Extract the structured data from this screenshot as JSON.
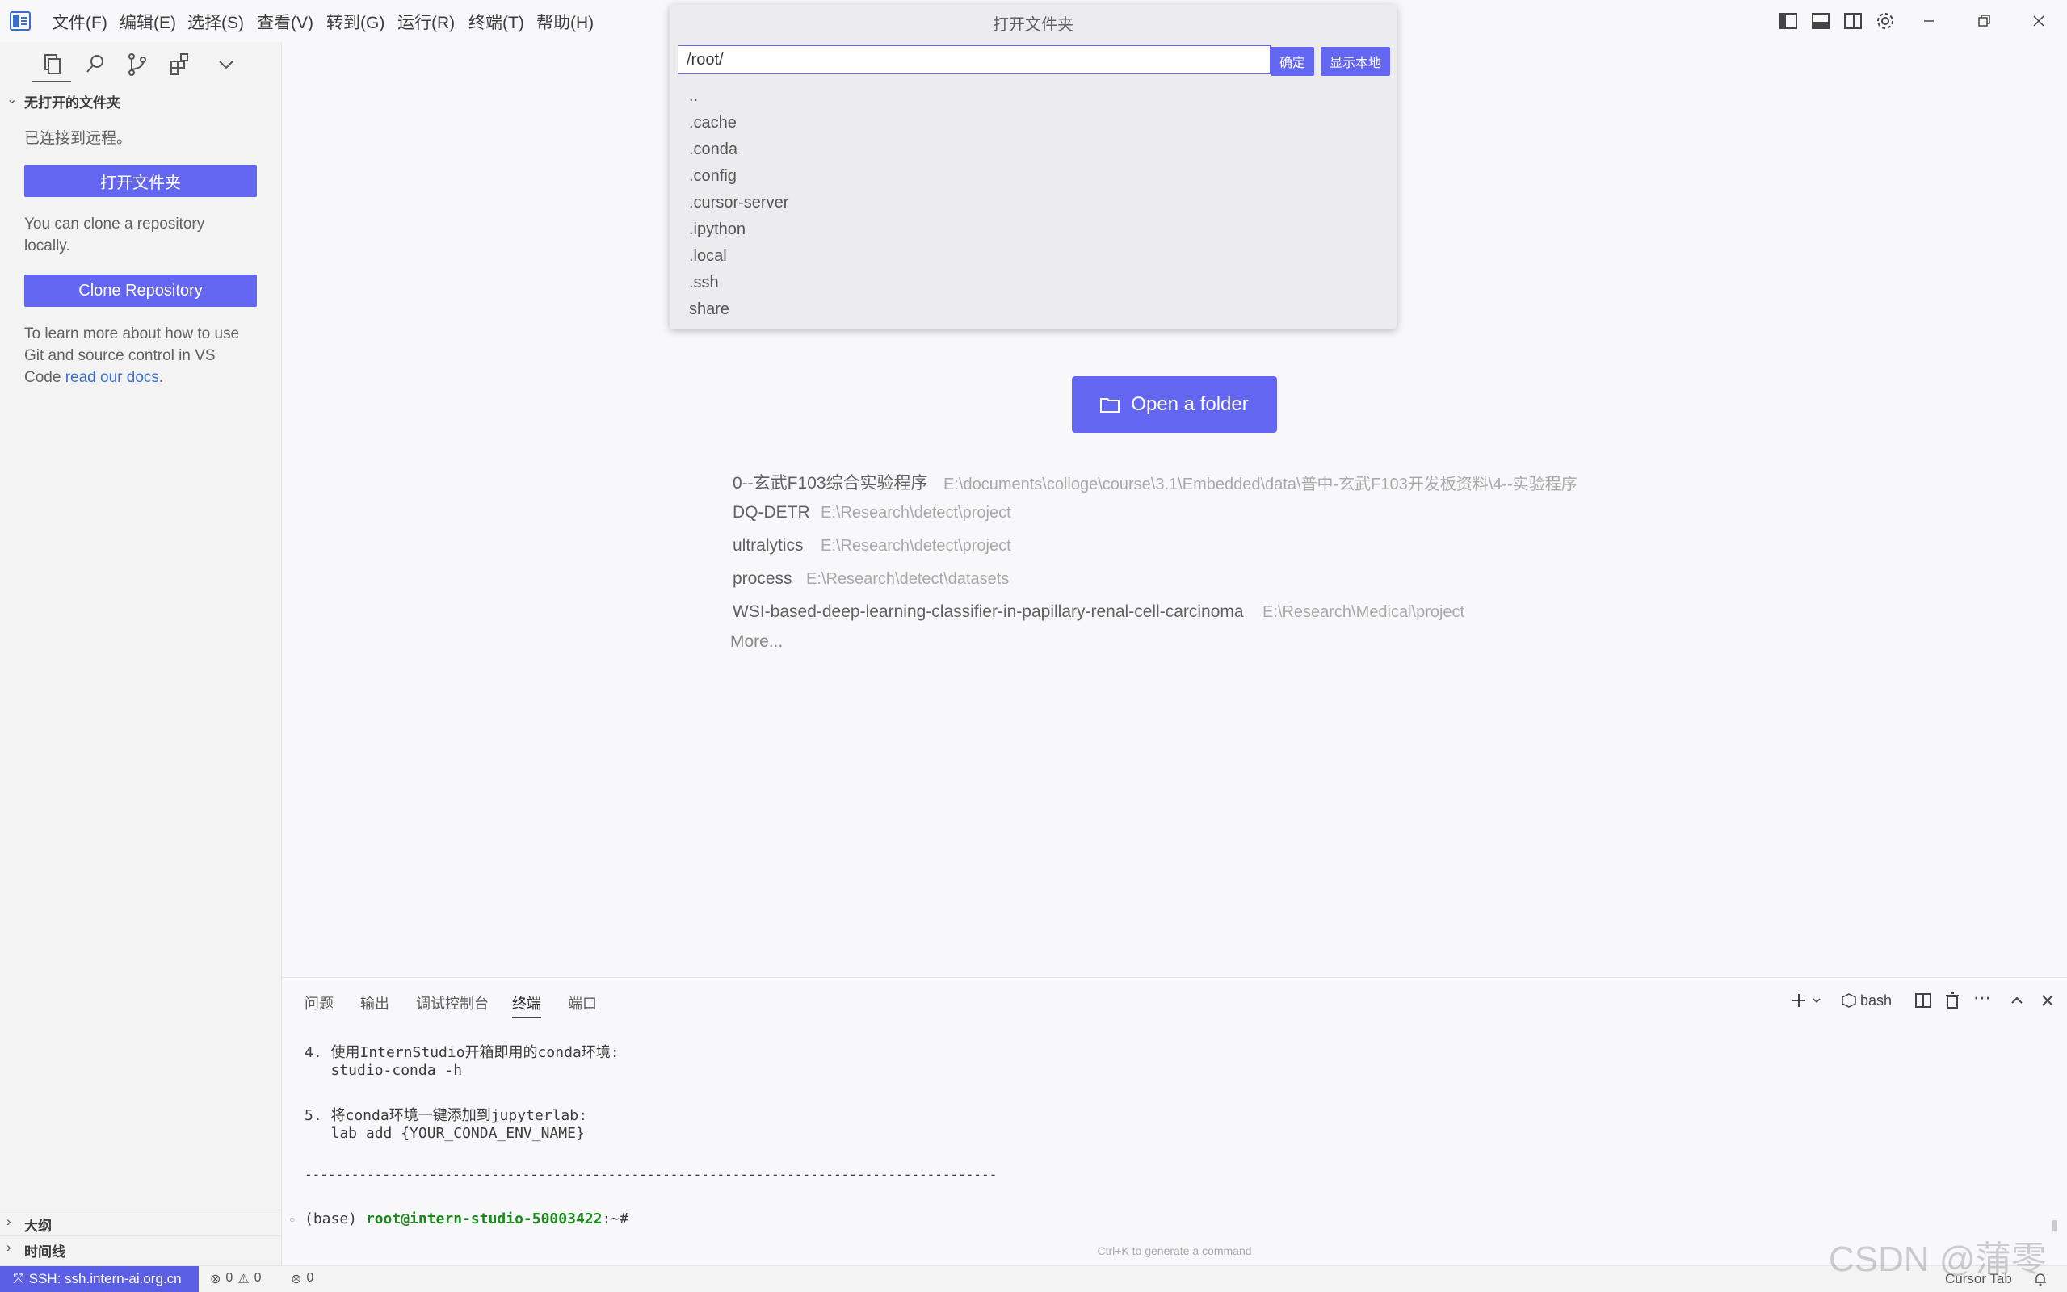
{
  "menu": [
    "文件(F)",
    "编辑(E)",
    "选择(S)",
    "查看(V)",
    "转到(G)",
    "运行(R)",
    "终端(T)",
    "帮助(H)"
  ],
  "sidebar": {
    "section_title": "无打开的文件夹",
    "connected_text": "已连接到远程。",
    "open_folder_label": "打开文件夹",
    "clone_hint_line1": "You can clone a repository",
    "clone_hint_line2": "locally.",
    "clone_label": "Clone Repository",
    "learn_line1": "To learn more about how to use",
    "learn_line2": "Git and source control in VS",
    "learn_line3_prefix": "Code ",
    "learn_link": "read our docs",
    "learn_suffix": ".",
    "outline_label": "大纲",
    "timeline_label": "时间线"
  },
  "quickpick": {
    "title": "打开文件夹",
    "input_value": "/root/",
    "ok_label": "确定",
    "show_local_label": "显示本地",
    "items": [
      "..",
      ".cache",
      ".conda",
      ".config",
      ".cursor-server",
      ".ipython",
      ".local",
      ".ssh",
      "share"
    ]
  },
  "welcome": {
    "open_folder_label": "Open a folder",
    "recent": [
      {
        "name": "0--玄武F103综合实验程序",
        "path": "E:\\documents\\colloge\\course\\3.1\\Embedded\\data\\普中-玄武F103开发板资料\\4--实验程序"
      },
      {
        "name": "DQ-DETR",
        "path": "E:\\Research\\detect\\project"
      },
      {
        "name": "ultralytics",
        "path": "E:\\Research\\detect\\project"
      },
      {
        "name": "process",
        "path": "E:\\Research\\detect\\datasets"
      },
      {
        "name": "WSI-based-deep-learning-classifier-in-papillary-renal-cell-carcinoma",
        "path": "E:\\Research\\Medical\\project"
      }
    ],
    "more_label": "More..."
  },
  "panel": {
    "tabs": [
      "问题",
      "输出",
      "调试控制台",
      "终端",
      "端口"
    ],
    "active_tab": "终端",
    "shell_label": "bash",
    "terminal_lines": [
      "4. 使用InternStudio开箱即用的conda环境:",
      "   studio-conda -h",
      "",
      "5. 将conda环境一键添加到jupyterlab:",
      "   lab add {YOUR_CONDA_ENV_NAME}",
      "",
      "-----------------------------------------------------------------------------------------"
    ],
    "prompt_base": "(base) ",
    "prompt_user": "root@intern-studio-50003422",
    "prompt_suffix": ":~#",
    "hint": "Ctrl+K to generate a command"
  },
  "statusbar": {
    "remote_label": "SSH: ssh.intern-ai.org.cn",
    "errors": "0",
    "warnings": "0",
    "ports": "0",
    "right_label": "Cursor Tab"
  },
  "watermark": "CSDN @蒲零",
  "colors": {
    "accent": "#6366f1",
    "link": "#3b6ec9",
    "remote": "#5b5fe6",
    "prompt_user": "#1a8a1a"
  }
}
